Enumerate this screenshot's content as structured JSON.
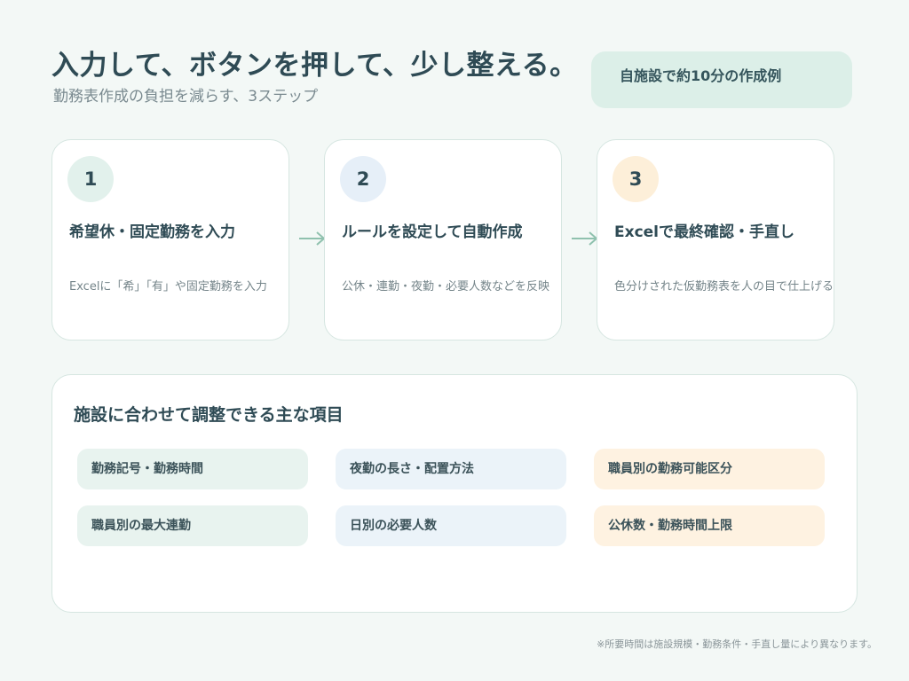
{
  "header": {
    "title": "入力して、ボタンを押して、少し整える。",
    "subtitle": "勤務表作成の負担を減らす、3ステップ",
    "badge": "自施設で約10分の作成例"
  },
  "steps": [
    {
      "number": "1",
      "title": "希望休・固定勤務を入力",
      "description": "Excelに「希」「有」や固定勤務を入力"
    },
    {
      "number": "2",
      "title": "ルールを設定して自動作成",
      "description": "公休・連勤・夜勤・必要人数などを反映"
    },
    {
      "number": "3",
      "title": "Excelで最終確認・手直し",
      "description": "色分けされた仮勤務表を人の目で仕上げる"
    }
  ],
  "adjustable": {
    "title": "施設に合わせて調整できる主な項目",
    "items": [
      {
        "label": "勤務記号・勤務時間"
      },
      {
        "label": "夜勤の長さ・配置方法"
      },
      {
        "label": "職員別の勤務可能区分"
      },
      {
        "label": "職員別の最大連勤"
      },
      {
        "label": "日別の必要人数"
      },
      {
        "label": "公休数・勤務時間上限"
      }
    ]
  },
  "footnote": "※所要時間は施設規模・勤務条件・手直し量により異なります。",
  "colors": {
    "background": "#f3f8f6",
    "text": "#2f4b55",
    "accent_green": "#e2f1ec",
    "accent_blue": "#e6eff8",
    "accent_orange": "#fdefd9",
    "arrow": "#8fc1ae"
  },
  "icons": {
    "step_connector": "arrow-right-icon"
  }
}
